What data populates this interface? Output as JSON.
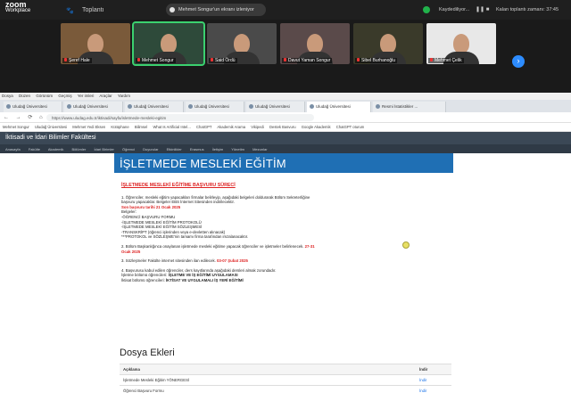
{
  "zoom": {
    "brand_line1": "zoom",
    "brand_line2": "Workplace",
    "home_icon": "paw-icon",
    "meeting_label": "Toplantı",
    "meeting_title": "Mehmet Songur'un ekranı izleniyor",
    "recording_label": "Kaydediliyor...",
    "pause_label": "❚❚ ■",
    "subtitle": "Kalan toplantı zamanı: 37:45"
  },
  "participants": [
    {
      "name": "Şeref Hale",
      "active": false,
      "muted": true,
      "bg": "#7a5a3a"
    },
    {
      "name": "Mehmet Songur",
      "active": true,
      "muted": true,
      "bg": "#2e4a3a"
    },
    {
      "name": "Said Ördü",
      "active": false,
      "muted": true,
      "bg": "#4a4a4a"
    },
    {
      "name": "Davut Yaman Songur",
      "active": false,
      "muted": true,
      "bg": "#5a4a4a"
    },
    {
      "name": "Sibel Burhanoğlu",
      "active": false,
      "muted": true,
      "bg": "#3a3a2a"
    },
    {
      "name": "Mehmet Çelik",
      "active": false,
      "muted": true,
      "bg": "#e8e8e8"
    }
  ],
  "browser": {
    "menu": [
      "Dosya",
      "Düzen",
      "Görünüm",
      "Geçmiş",
      "Yer imleri",
      "Araçlar",
      "Yardım"
    ],
    "tabs": [
      {
        "label": "Uludağ Üniversitesi",
        "active": false
      },
      {
        "label": "Uludağ Üniversitesi",
        "active": false
      },
      {
        "label": "Uludağ Üniversitesi",
        "active": false
      },
      {
        "label": "Uludağ Üniversitesi",
        "active": false
      },
      {
        "label": "Uludağ Üniversitesi",
        "active": false
      },
      {
        "label": "Uludağ Üniversitesi",
        "active": true
      },
      {
        "label": "Resmi İstatistikler ...",
        "active": false
      }
    ],
    "url": "https://www.uludag.edu.tr/iktisadi/sayfa/isletmede-mesleki-egitim",
    "bookmarks": [
      "Mehmet Songur",
      "Uludağ Üniversitesi",
      "Mehmet Yedi Eksen",
      "Kütüphane",
      "Bilimsel",
      "What Is Artificial Intel...",
      "ChatGPT",
      "Akademik Arama",
      "Vikipedi",
      "Destek Basvuru",
      "Google Akademik",
      "ChatGPT oturum"
    ]
  },
  "faculty": {
    "name": "İktisadi ve İdari Bilimler Fakültesi",
    "nav": [
      "Anasayfa",
      "Fakülte",
      "Akademik",
      "Bölümler",
      "İdari Birimler",
      "Öğrenci",
      "Duyurular",
      "Etkinlikler",
      "Erasmus",
      "İletişim",
      "Yönetim",
      "Mezunlar"
    ]
  },
  "page": {
    "title": "İŞLETMEDE MESLEKİ EĞİTİM",
    "section_title": "İŞLETMEDE MESLEKİ EĞİTİME BAŞVURU SÜRECİ",
    "item1": "1. Öğrenciler, mesleki eğitim yapacakları firmalar belirleyip, aşağıdaki belgeleri doldurarak Bölüm Sekreterliğine başvuru yapacaklar. Belgeler EBS İnternet Sitesinden indirilecektir.",
    "deadline1": "Son başvuru tarihi 21 Ocak 2025",
    "docs": [
      "-ÖĞRENCİ BAŞVURU FORMU",
      "-İŞLETMEDE MESLEKİ EĞİTİM PROTOKOLÜ",
      "-İŞLETMEDE MESLEKİ EĞİTİM SÖZLEŞMESİ",
      "-TRANSKRİPT (öğrenci işlerinden veya e-devletten alınacak)"
    ],
    "docs_label": "Belgeler:",
    "note": "***PROTOKOL ve SÖZLEŞME'nin tamamı firma tarafından imzalanacaktır.",
    "item2": "2. Bölüm Başkanlığınca onaylanan işletmede mesleki eğitime yapacak öğrenciler ve işletmeler belirlenecek.",
    "item2_date": "27-31 Ocak 2025",
    "item3": "3. Sözleşmeler Fakülte internet sitesinden ilan edilecek.",
    "item3_date": "03-07 Şubat 2025",
    "item4": "4. Başvurusu kabul edilen öğrenciler, ders kayıtlarında aşağıdaki dersleri almak zorundadır.",
    "course1_label": "İşletme bölümü öğrencileri:",
    "course1": "İŞLETME VE İŞ EĞİTİMİ UYGULAMASI",
    "course2_label": "İktisat bölümü öğrencileri:",
    "course2": "İKTİSAT VE UYGULAMALI İŞ YERİ EĞİTİMİ"
  },
  "attachments": {
    "title": "Dosya Ekleri",
    "col_name": "Açıklama",
    "col_link": "İndir",
    "rows": [
      {
        "name": "İşletmede Mesleki Eğitim YÖNERGESİ",
        "link": "İndir"
      },
      {
        "name": "Öğrenci Başvuru Formu",
        "link": "İndir"
      }
    ]
  }
}
